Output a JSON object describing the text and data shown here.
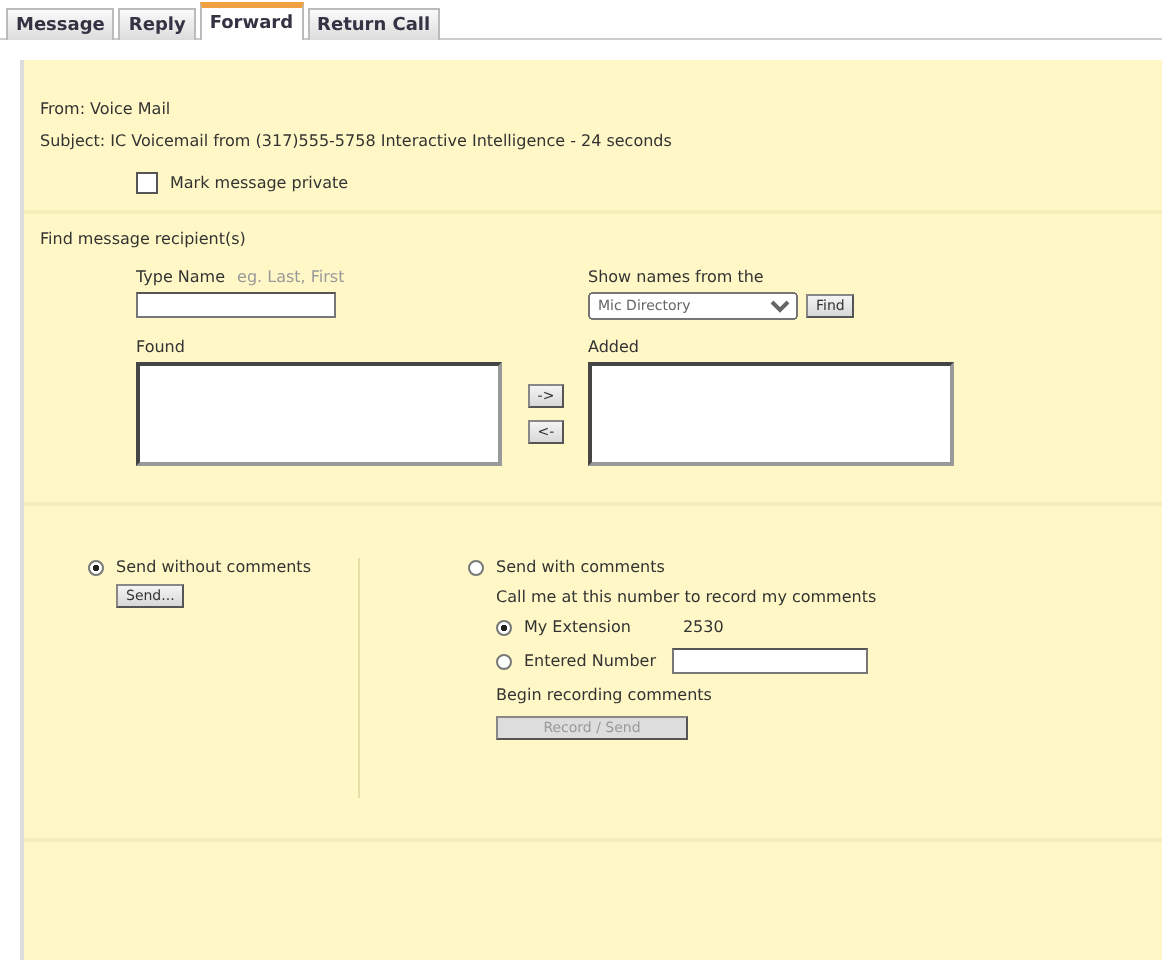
{
  "tabs": [
    {
      "label": "Message",
      "selected": false
    },
    {
      "label": "Reply",
      "selected": false
    },
    {
      "label": "Forward",
      "selected": true
    },
    {
      "label": "Return Call",
      "selected": false
    }
  ],
  "from": "From: Voice Mail",
  "subject": "Subject: IC Voicemail from (317)555-5758 Interactive Intelligence - 24 seconds",
  "private_checkbox": {
    "label": "Mark message private",
    "checked": false
  },
  "recipients": {
    "heading": "Find message recipient(s)",
    "type_name_label": "Type Name",
    "type_name_hint": "eg. Last, First",
    "show_names_label": "Show names from the",
    "directory": "Mic Directory",
    "find_button": "Find",
    "found_label": "Found",
    "added_label": "Added",
    "add_button": "->",
    "remove_button": "<-"
  },
  "send_without": {
    "label": "Send without comments",
    "selected": true,
    "button": "Send..."
  },
  "send_with": {
    "label": "Send with comments",
    "selected": false,
    "call_me": "Call me at this number to record my comments",
    "options": [
      {
        "label": "My Extension",
        "selected": true,
        "value": "2530",
        "kind": "text"
      },
      {
        "label": "Entered Number",
        "selected": false,
        "kind": "field"
      }
    ],
    "begin_label": "Begin recording comments",
    "record_button": "Record / Send",
    "record_disabled": true
  }
}
